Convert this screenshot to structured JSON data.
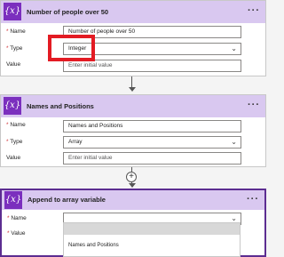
{
  "card1": {
    "icon": "{x}",
    "title": "Number of people over 50",
    "menu": "···",
    "name_label": "Name",
    "name_value": "Number of people over 50",
    "type_label": "Type",
    "type_value": "Integer",
    "value_label": "Value",
    "value_placeholder": "Enter initial value"
  },
  "card2": {
    "icon": "{x}",
    "title": "Names and Positions",
    "menu": "···",
    "name_label": "Name",
    "name_value": "Names and Positions",
    "type_label": "Type",
    "type_value": "Array",
    "value_label": "Value",
    "value_placeholder": "Enter initial value"
  },
  "card3": {
    "icon": "{x}",
    "title": "Append to array variable",
    "menu": "···",
    "name_label": "Name",
    "name_value": "",
    "value_label": "Value",
    "dropdown_options": [
      "Names and Positions"
    ]
  },
  "connector": {
    "add_icon": "+"
  },
  "colors": {
    "header_bg": "#d9c8f0",
    "icon_bg": "#7b2fbe",
    "highlight": "#e31b23",
    "required": "#d13438"
  },
  "icons": {
    "variable": "variable-icon",
    "menu": "more-options-icon",
    "chevron": "chevron-down-icon",
    "add": "plus-circle-icon"
  }
}
